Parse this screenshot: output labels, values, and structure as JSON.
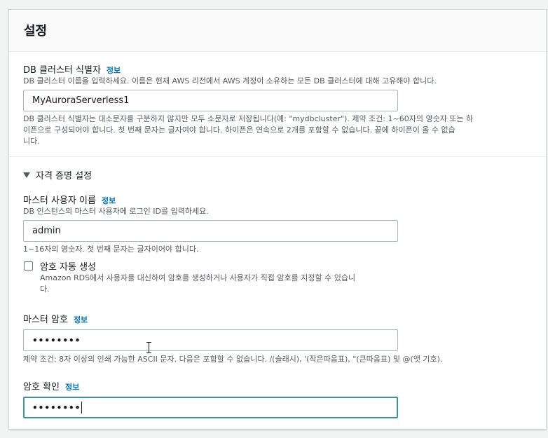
{
  "panel": {
    "title": "설정"
  },
  "db_cluster_identifier": {
    "label": "DB 클러스터 식별자",
    "info": "정보",
    "description": "DB 클러스터 이름을 입력하세요. 이름은 현재 AWS 리전에서 AWS 계정이 소유하는 모든 DB 클러스터에 대해 고유해야 합니다.",
    "value": "MyAuroraServerless1",
    "constraint_line1": "DB 클러스터 식별자는 대소문자를 구분하지 않지만 모두 소문자로 저장됩니다(예: \"mydbcluster\"). 제약 조건: 1~60자의 영숫자 또는 하",
    "constraint_line2": "이픈으로 구성되어야 합니다. 첫 번째 문자는 글자여야 합니다. 하이픈은 연속으로 2개를 포함할 수 없습니다. 끝에 하이픈이 올 수 없습",
    "constraint_line3": "니다."
  },
  "credentials": {
    "section_title": "자격 증명 설정",
    "caret_icon": "caret-down-icon",
    "master_username": {
      "label": "마스터 사용자 이름",
      "info": "정보",
      "description": "DB 인스턴스의 마스터 사용자에 로그인 ID를 입력하세요.",
      "value": "admin",
      "constraint": "1~16자의 영숫자. 첫 번째 문자는 글자이어야 합니다."
    },
    "auto_generate": {
      "label": "암호 자동 생성",
      "checked": false,
      "description_line1": "Amazon RDS에서 사용자를 대신하여 암호를 생성하거나 사용자가 직접 암호를 지정할 수 있습니",
      "description_line2": "다."
    },
    "master_password": {
      "label": "마스터 암호",
      "info": "정보",
      "value": "••••••••",
      "constraint": "제약 조건: 8자 이상의 인쇄 가능한 ASCII 문자. 다음은 포함할 수 없습니다. /(슬래시), '(작은따옴표), \"(큰따옴표) 및 @(앳 기호)."
    },
    "confirm_password": {
      "label": "암호 확인",
      "info": "정보",
      "value": "••••••••"
    }
  },
  "colors": {
    "link": "#0073bb",
    "focus_border": "#3a9594"
  }
}
